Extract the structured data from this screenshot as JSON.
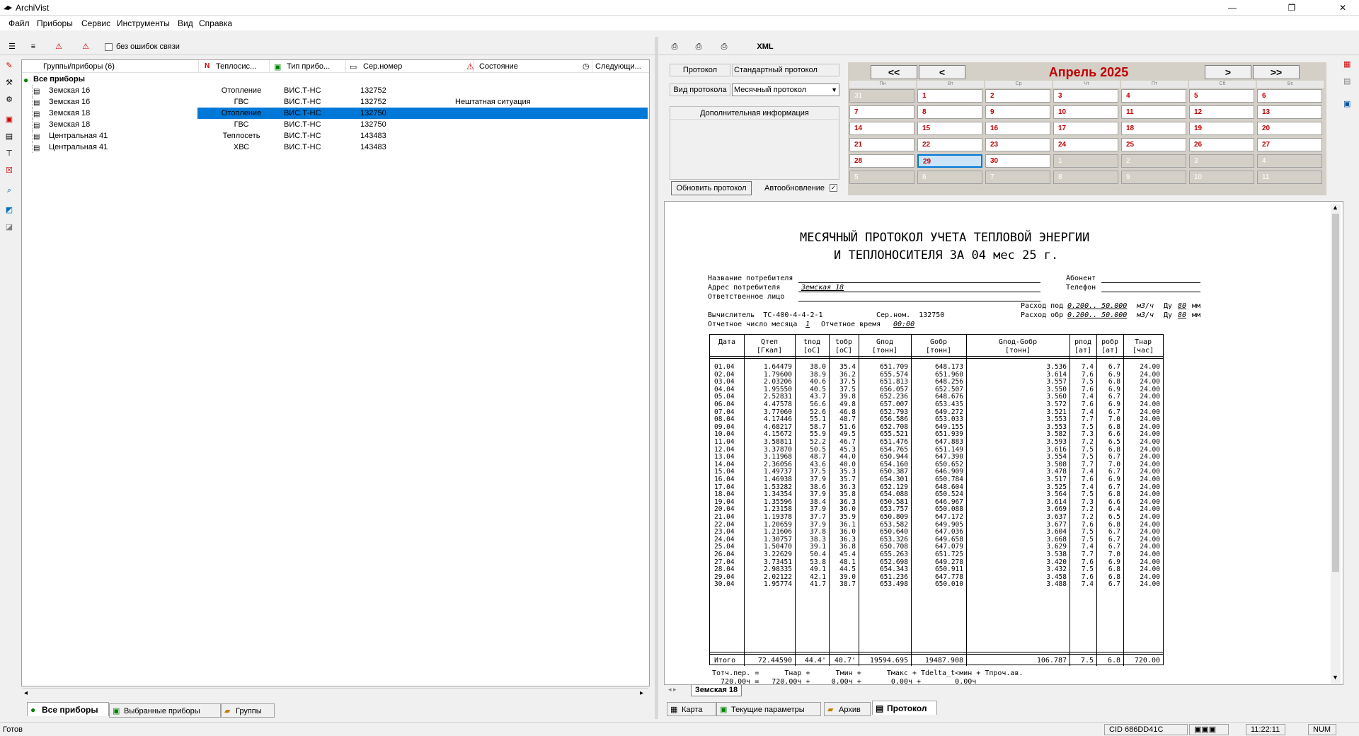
{
  "window": {
    "title": "ArchiVist",
    "minimize": "—",
    "maximize": "❐",
    "close": "✕"
  },
  "menu": [
    "Файл",
    "Приборы",
    "Сервис",
    "Инструменты",
    "Вид",
    "Справка"
  ],
  "left_toolbar": {
    "checkbox_label": "без ошибок связи"
  },
  "columns": {
    "groups": "Группы/приборы (6)",
    "heat": "Теплосис...",
    "type": "Тип прибо...",
    "serial": "Сер.номер",
    "state": "Состояние",
    "next": "Следующи..."
  },
  "tree_root": "Все приборы",
  "devices": [
    {
      "name": "Земская 16",
      "system": "Отопление",
      "type": "ВИС.Т-НС",
      "serial": "132752",
      "state": ""
    },
    {
      "name": "Земская 16",
      "system": "ГВС",
      "type": "ВИС.Т-НС",
      "serial": "132752",
      "state": "Нештатная ситуация"
    },
    {
      "name": "Земская 18",
      "system": "Отопление",
      "type": "ВИС.Т-НС",
      "serial": "132750",
      "state": ""
    },
    {
      "name": "Земская 18",
      "system": "ГВС",
      "type": "ВИС.Т-НС",
      "serial": "132750",
      "state": ""
    },
    {
      "name": "Центральная 41",
      "system": "Теплосеть",
      "type": "ВИС.Т-НС",
      "serial": "143483",
      "state": ""
    },
    {
      "name": "Центральная 41",
      "system": "ХВС",
      "type": "ВИС.Т-НС",
      "serial": "143483",
      "state": ""
    }
  ],
  "left_tabs": [
    "Все приборы",
    "Выбранные приборы",
    "Группы"
  ],
  "right_toolbar": {
    "xml": "XML"
  },
  "protocol_panel": {
    "protocol_label": "Протокол",
    "protocol_value": "Стандартный протокол",
    "kind_label": "Вид протокола",
    "kind_value": "Месячный протокол",
    "info_label": "Дополнительная информация",
    "refresh_button": "Обновить протокол",
    "autoupdate_label": "Автообновление",
    "autoupdate_checked": true
  },
  "calendar": {
    "month": "Апрель 2025",
    "prev_prev": "<<",
    "prev": "<",
    "next": ">",
    "next_next": ">>",
    "weekdays": [
      "Пн",
      "Вт",
      "Ср",
      "Чт",
      "Пт",
      "Сб",
      "Вс"
    ],
    "weeks": [
      [
        "31",
        "1",
        "2",
        "3",
        "4",
        "5",
        "6"
      ],
      [
        "7",
        "8",
        "9",
        "10",
        "11",
        "12",
        "13"
      ],
      [
        "14",
        "15",
        "16",
        "17",
        "18",
        "19",
        "20"
      ],
      [
        "21",
        "22",
        "23",
        "24",
        "25",
        "26",
        "27"
      ],
      [
        "28",
        "29",
        "30",
        "1",
        "2",
        "3",
        "4"
      ],
      [
        "5",
        "6",
        "7",
        "8",
        "9",
        "10",
        "11"
      ]
    ],
    "selected": "29"
  },
  "report": {
    "title1": "МЕСЯЧНЫЙ ПРОТОКОЛ УЧЕТА ТЕПЛОВОЙ ЭНЕРГИИ",
    "title2": "И ТЕПЛОНОСИТЕЛЯ ЗА 04 мес 25 г.",
    "consumer_label": "Название потребителя",
    "address_label": "Адрес потребителя",
    "address_value": "Земская 18",
    "responsible_label": "Ответственное лицо",
    "subscriber_label": "Абонент",
    "phone_label": "Телефон",
    "flow_supply": "Расход под",
    "flow_supply_range": "0.200.. 50.000",
    "flow_unit": "м3/ч",
    "du_label": "Ду",
    "du_value": "80",
    "du_unit": "мм",
    "flow_return": "Расход обр",
    "flow_return_range": "0.200.. 50.000",
    "calculator": "Вычислитель  ТС-400-4-4-2-1",
    "serial": "Сер.ном.  132750",
    "report_day_label": "Отчетное число месяца",
    "report_day": "1",
    "report_time_label": "Отчетное время",
    "report_time": "00:00",
    "headers": [
      [
        "Дата",
        ""
      ],
      [
        "Qтеп",
        "[Гкал]"
      ],
      [
        "tпод",
        "[оС]"
      ],
      [
        "tобр",
        "[оС]"
      ],
      [
        "Gпод",
        "[тонн]"
      ],
      [
        "Gобр",
        "[тонн]"
      ],
      [
        "Gпод-Gобр",
        "[тонн]"
      ],
      [
        "pпод",
        "[ат]"
      ],
      [
        "pобр",
        "[ат]"
      ],
      [
        "Tнар",
        "[час]"
      ]
    ],
    "rows": [
      [
        "01.04",
        "1.64479",
        "38.0",
        "35.4",
        "651.709",
        "648.173",
        "3.536",
        "7.4",
        "6.7",
        "24.00"
      ],
      [
        "02.04",
        "1.79600",
        "38.9",
        "36.2",
        "655.574",
        "651.960",
        "3.614",
        "7.6",
        "6.9",
        "24.00"
      ],
      [
        "03.04",
        "2.03206",
        "40.6",
        "37.5",
        "651.813",
        "648.256",
        "3.557",
        "7.5",
        "6.8",
        "24.00"
      ],
      [
        "04.04",
        "1.95550",
        "40.5",
        "37.5",
        "656.057",
        "652.507",
        "3.550",
        "7.6",
        "6.9",
        "24.00"
      ],
      [
        "05.04",
        "2.52831",
        "43.7",
        "39.8",
        "652.236",
        "648.676",
        "3.560",
        "7.4",
        "6.7",
        "24.00"
      ],
      [
        "06.04",
        "4.47578",
        "56.6",
        "49.8",
        "657.007",
        "653.435",
        "3.572",
        "7.6",
        "6.9",
        "24.00"
      ],
      [
        "07.04",
        "3.77060",
        "52.6",
        "46.8",
        "652.793",
        "649.272",
        "3.521",
        "7.4",
        "6.7",
        "24.00"
      ],
      [
        "08.04",
        "4.17446",
        "55.1",
        "48.7",
        "656.586",
        "653.033",
        "3.553",
        "7.7",
        "7.0",
        "24.00"
      ],
      [
        "09.04",
        "4.68217",
        "58.7",
        "51.6",
        "652.708",
        "649.155",
        "3.553",
        "7.5",
        "6.8",
        "24.00"
      ],
      [
        "10.04",
        "4.15672",
        "55.9",
        "49.5",
        "655.521",
        "651.939",
        "3.582",
        "7.3",
        "6.6",
        "24.00"
      ],
      [
        "11.04",
        "3.58811",
        "52.2",
        "46.7",
        "651.476",
        "647.883",
        "3.593",
        "7.2",
        "6.5",
        "24.00"
      ],
      [
        "12.04",
        "3.37870",
        "50.5",
        "45.3",
        "654.765",
        "651.149",
        "3.616",
        "7.5",
        "6.8",
        "24.00"
      ],
      [
        "13.04",
        "3.11968",
        "48.7",
        "44.0",
        "650.944",
        "647.390",
        "3.554",
        "7.5",
        "6.7",
        "24.00"
      ],
      [
        "14.04",
        "2.36056",
        "43.6",
        "40.0",
        "654.160",
        "650.652",
        "3.508",
        "7.7",
        "7.0",
        "24.00"
      ],
      [
        "15.04",
        "1.49737",
        "37.5",
        "35.3",
        "650.387",
        "646.909",
        "3.478",
        "7.4",
        "6.7",
        "24.00"
      ],
      [
        "16.04",
        "1.46938",
        "37.9",
        "35.7",
        "654.301",
        "650.784",
        "3.517",
        "7.6",
        "6.9",
        "24.00"
      ],
      [
        "17.04",
        "1.53282",
        "38.6",
        "36.3",
        "652.129",
        "648.604",
        "3.525",
        "7.4",
        "6.7",
        "24.00"
      ],
      [
        "18.04",
        "1.34354",
        "37.9",
        "35.8",
        "654.088",
        "650.524",
        "3.564",
        "7.5",
        "6.8",
        "24.00"
      ],
      [
        "19.04",
        "1.35596",
        "38.4",
        "36.3",
        "650.581",
        "646.967",
        "3.614",
        "7.3",
        "6.6",
        "24.00"
      ],
      [
        "20.04",
        "1.23158",
        "37.9",
        "36.0",
        "653.757",
        "650.088",
        "3.669",
        "7.2",
        "6.4",
        "24.00"
      ],
      [
        "21.04",
        "1.19378",
        "37.7",
        "35.9",
        "650.809",
        "647.172",
        "3.637",
        "7.2",
        "6.5",
        "24.00"
      ],
      [
        "22.04",
        "1.20659",
        "37.9",
        "36.1",
        "653.582",
        "649.905",
        "3.677",
        "7.6",
        "6.8",
        "24.00"
      ],
      [
        "23.04",
        "1.21606",
        "37.8",
        "36.0",
        "650.640",
        "647.036",
        "3.604",
        "7.5",
        "6.7",
        "24.00"
      ],
      [
        "24.04",
        "1.30757",
        "38.3",
        "36.3",
        "653.326",
        "649.658",
        "3.668",
        "7.5",
        "6.7",
        "24.00"
      ],
      [
        "25.04",
        "1.50470",
        "39.1",
        "36.8",
        "650.708",
        "647.079",
        "3.629",
        "7.4",
        "6.7",
        "24.00"
      ],
      [
        "26.04",
        "3.22629",
        "50.4",
        "45.4",
        "655.263",
        "651.725",
        "3.538",
        "7.7",
        "7.0",
        "24.00"
      ],
      [
        "27.04",
        "3.73451",
        "53.8",
        "48.1",
        "652.698",
        "649.278",
        "3.420",
        "7.6",
        "6.9",
        "24.00"
      ],
      [
        "28.04",
        "2.98335",
        "49.1",
        "44.5",
        "654.343",
        "650.911",
        "3.432",
        "7.5",
        "6.8",
        "24.00"
      ],
      [
        "29.04",
        "2.02122",
        "42.1",
        "39.0",
        "651.236",
        "647.778",
        "3.458",
        "7.6",
        "6.8",
        "24.00"
      ],
      [
        "30.04",
        "1.95774",
        "41.7",
        "38.7",
        "653.498",
        "650.010",
        "3.488",
        "7.4",
        "6.7",
        "24.00"
      ]
    ],
    "total": [
      "Итого",
      "72.44590",
      "44.4'",
      "40.7'",
      "19594.695",
      "19487.908",
      "106.787",
      "7.5",
      "6.8",
      "720.00"
    ],
    "footer1": "Тотч.пер. =      Тнар +      Тмин +      Тмакс + Тdelta_t<мин + Тпроч.ав.",
    "footer2": "  720.00ч =   720.00ч +     0.00ч +       0.00ч +        0.00ч"
  },
  "doc_tab": "Земская 18",
  "right_tabs": [
    "Карта",
    "Текущие параметры",
    "Архив",
    "Протокол"
  ],
  "status": {
    "ready": "Готов",
    "cid": "CID 686DD41C",
    "time": "11:22:11",
    "num": "NUM"
  }
}
